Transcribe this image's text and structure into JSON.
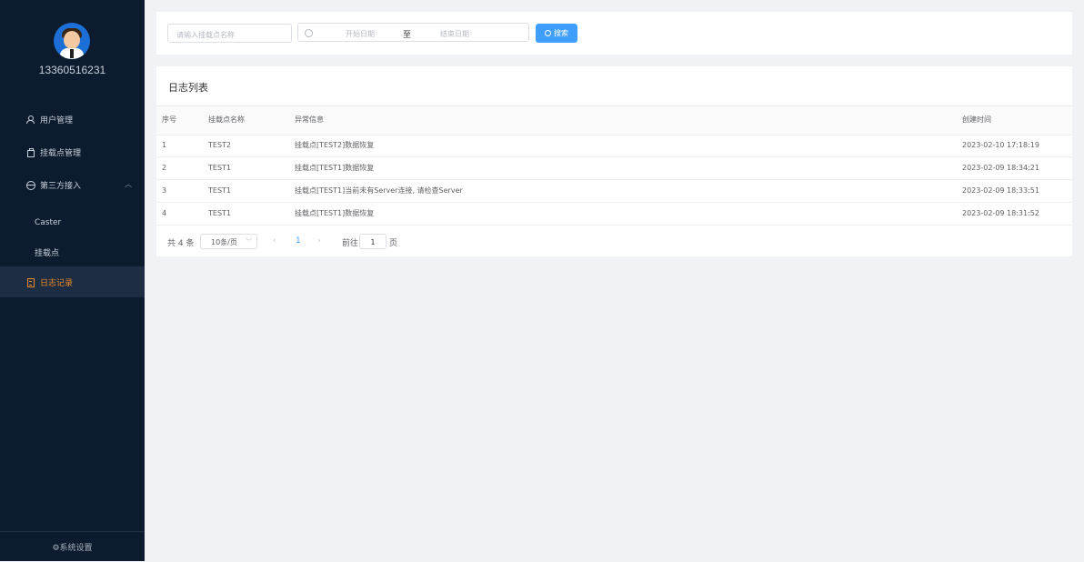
{
  "user": {
    "phone": "13360516231"
  },
  "sidebar": {
    "items": [
      {
        "label": "用户管理",
        "icon": "user-icon"
      },
      {
        "label": "挂载点管理",
        "icon": "bag-icon"
      },
      {
        "label": "第三方接入",
        "icon": "globe-icon",
        "expanded": true,
        "children": [
          {
            "label": "Caster"
          },
          {
            "label": "挂载点"
          }
        ]
      },
      {
        "label": "日志记录",
        "icon": "document-icon",
        "active": true
      }
    ],
    "footer": "⚙系统设置",
    "active_color": "#f08a24"
  },
  "search": {
    "name_placeholder": "请输入挂载点名称",
    "start_placeholder": "开始日期",
    "separator": "至",
    "end_placeholder": "结束日期",
    "button_label": "搜索",
    "button_color": "#409eff"
  },
  "logs": {
    "title": "日志列表",
    "columns": [
      "序号",
      "挂载点名称",
      "异常信息",
      "创建时间"
    ],
    "rows": [
      {
        "index": "1",
        "name": "TEST2",
        "message": "挂载点[TEST2]数据恢复",
        "time": "2023-02-10 17:18:19"
      },
      {
        "index": "2",
        "name": "TEST1",
        "message": "挂载点[TEST1]数据恢复",
        "time": "2023-02-09 18:34:21"
      },
      {
        "index": "3",
        "name": "TEST1",
        "message": "挂载点[TEST1]当前未有Server连接, 请检查Server",
        "time": "2023-02-09 18:33:51"
      },
      {
        "index": "4",
        "name": "TEST1",
        "message": "挂载点[TEST1]数据恢复",
        "time": "2023-02-09 18:31:52"
      }
    ]
  },
  "pagination": {
    "total": "共 4 条",
    "page_size": "10条/页",
    "prev": "‹",
    "current": "1",
    "next": "›",
    "goto_label": "前往",
    "goto_value": "1",
    "page_suffix": "页"
  }
}
